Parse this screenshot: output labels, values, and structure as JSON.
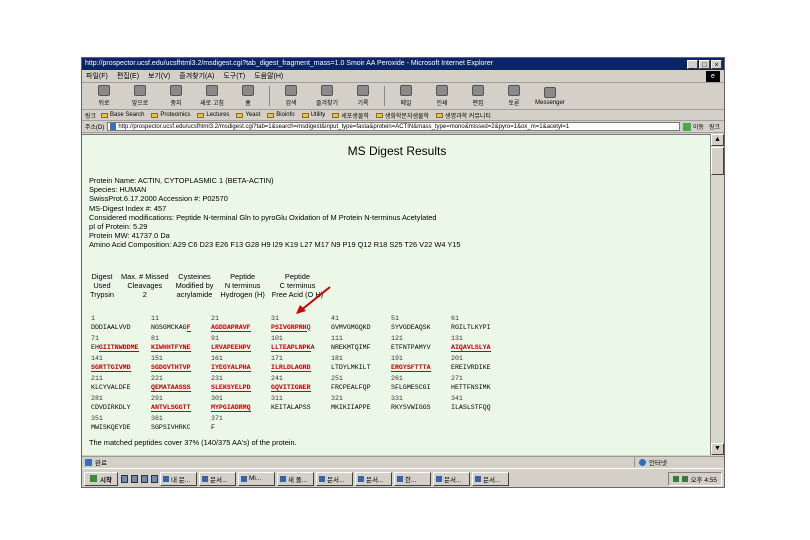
{
  "window": {
    "title": "http://prospector.ucsf.edu/ucsfhtml3.2/msdigest.cgi?tab_digest_fragment_mass=1.0 Smoir AA Peroxide - Microsoft Internet Explorer",
    "buttons": [
      "_",
      "□",
      "×"
    ]
  },
  "menubar": {
    "items": [
      "파일(F)",
      "편집(E)",
      "보기(V)",
      "즐겨찾기(A)",
      "도구(T)",
      "도움말(H)"
    ]
  },
  "toolbar": {
    "buttons": [
      "뒤로",
      "앞으로",
      "중지",
      "새로 고침",
      "홈",
      "검색",
      "즐겨찾기",
      "기록",
      "메일",
      "인쇄",
      "편집",
      "토론",
      "Messenger"
    ]
  },
  "links": {
    "label": "링크",
    "items": [
      "Base Search",
      "Proteomics",
      "Lectures",
      "Yeast",
      "Bioinfo",
      "Utility",
      "세포생물학",
      "생화학분자생물학",
      "생명과학 커뮤니티"
    ]
  },
  "address": {
    "label": "주소(D)",
    "url": "http://prospector.ucsf.edu/ucsfhtml3.2/msdigest.cgi?tab=1&search=msdigest&input_type=fasta&protein=ACTIN&mass_type=mono&missed=2&pyro=1&ox_m=1&acetyl=1",
    "go_label": "이동",
    "links_label": "링크"
  },
  "page": {
    "heading": "MS  Digest  Results",
    "protein_name": "Protein Name: ACTIN, CYTOPLASMIC 1 (BETA-ACTIN)",
    "species": "Species: HUMAN",
    "accession": "SwissProt.6.17.2000 Accession #: P02570",
    "index": "MS-Digest Index #: 457",
    "modifications": "Considered modifications:  Peptide N-terminal Gln to pyroGlu   Oxidation of M   Protein N-terminus Acetylated",
    "pi": "pI of Protein: 5.29",
    "mw": "Protein MW: 41737.0 Da",
    "composition": "Amino Acid Composition: A29 C6 D23 E26 F13 G28 H9 I29 K19 L27 M17 N9 P19 Q12 R18 S25 T26 V22 W4 Y15",
    "params": {
      "headers": [
        [
          "Digest",
          "Used"
        ],
        [
          "Max. # Missed",
          "Cleavages"
        ],
        [
          "Cysteines",
          "Modified by"
        ],
        [
          "Peptide",
          "N terminus"
        ],
        [
          "Peptide",
          "C terminus"
        ]
      ],
      "values": [
        "Trypsin",
        "2",
        "acrylamide",
        "Hydrogen (H)",
        "Free Acid (O H)"
      ]
    },
    "sequence": [
      {
        "nums": [
          "1",
          "11",
          "21",
          "31",
          "41",
          "51",
          "61"
        ],
        "segs": [
          [
            [
              "DDDIAALVVD",
              0
            ]
          ],
          [
            [
              "NGSGMCKAG",
              0
            ],
            [
              "F",
              1
            ]
          ],
          [
            [
              "AGDDAPRAVF",
              1
            ]
          ],
          [
            [
              "PSIVGRPRH",
              1
            ],
            [
              "Q",
              0
            ]
          ],
          [
            [
              "GVMVGMGQKD",
              0
            ]
          ],
          [
            [
              "SYVGDEAQSK",
              0
            ]
          ],
          [
            [
              "RGILTLKYPI",
              0
            ]
          ]
        ]
      },
      {
        "nums": [
          "71",
          "81",
          "91",
          "101",
          "111",
          "121",
          "131"
        ],
        "segs": [
          [
            [
              "EH",
              0
            ],
            [
              "GIITNWDDME",
              1
            ]
          ],
          [
            [
              "KIWHHTFYNE",
              1
            ]
          ],
          [
            [
              "LRVAPEEHPV",
              1
            ]
          ],
          [
            [
              "LLTEAPLNPK",
              1
            ],
            [
              "A",
              0
            ]
          ],
          [
            [
              "NREKMTQIMF",
              0
            ]
          ],
          [
            [
              "ETFNTPAMYV",
              0
            ]
          ],
          [
            [
              "AIQAVLSLYA",
              1
            ]
          ]
        ]
      },
      {
        "nums": [
          "141",
          "151",
          "161",
          "171",
          "181",
          "191",
          "201"
        ],
        "segs": [
          [
            [
              "SGRTTGIVMD",
              1
            ]
          ],
          [
            [
              "SGDGVTHTVP",
              1
            ]
          ],
          [
            [
              "IYEGYALPHA",
              1
            ]
          ],
          [
            [
              "ILRLDLAGRD",
              1
            ]
          ],
          [
            [
              "LTDYLMKILT",
              0
            ]
          ],
          [
            [
              "ERGYSFTTTA",
              1
            ]
          ],
          [
            [
              "EREIVRDIKE",
              0
            ]
          ]
        ]
      },
      {
        "nums": [
          "211",
          "221",
          "231",
          "241",
          "251",
          "261",
          "271"
        ],
        "segs": [
          [
            [
              "KLCYVALDFE",
              0
            ]
          ],
          [
            [
              "QEMATAASSS",
              1
            ]
          ],
          [
            [
              "SLEKSYELPD",
              1
            ]
          ],
          [
            [
              "GQVITIGNER",
              1
            ]
          ],
          [
            [
              "FRCPEALFQP",
              0
            ]
          ],
          [
            [
              "SFLGMESCGI",
              0
            ]
          ],
          [
            [
              "HETTFNSIMK",
              0
            ]
          ]
        ]
      },
      {
        "nums": [
          "281",
          "291",
          "301",
          "311",
          "321",
          "331",
          "341"
        ],
        "segs": [
          [
            [
              "CDVDIRKDLY",
              0
            ]
          ],
          [
            [
              "ANTVLSGGTT",
              1
            ]
          ],
          [
            [
              "MYPGIADRMQ",
              1
            ]
          ],
          [
            [
              "KEITALAPSS",
              0
            ]
          ],
          [
            [
              "MKIKIIAPPE",
              0
            ]
          ],
          [
            [
              "RKYSVWIGGS",
              0
            ]
          ],
          [
            [
              "ILASLSTFQQ",
              0
            ]
          ]
        ]
      },
      {
        "nums": [
          "351",
          "361",
          "371"
        ],
        "segs": [
          [
            [
              "MWISKQEYDE",
              0
            ]
          ],
          [
            [
              "SGPSIVHRKC",
              0
            ]
          ],
          [
            [
              "F",
              0
            ]
          ]
        ]
      }
    ],
    "summary": "The matched peptides cover 37% (140/375 AA's) of the protein."
  },
  "statusbar": {
    "left": "완료",
    "zone": "인터넷"
  },
  "taskbar": {
    "start": "시작",
    "tasks": [
      "내 문...",
      "문서...",
      "Mi...",
      "새 폴...",
      "문서...",
      "문서...",
      "한...",
      "문서...",
      "문서..."
    ],
    "clock": "오후 4:55"
  }
}
